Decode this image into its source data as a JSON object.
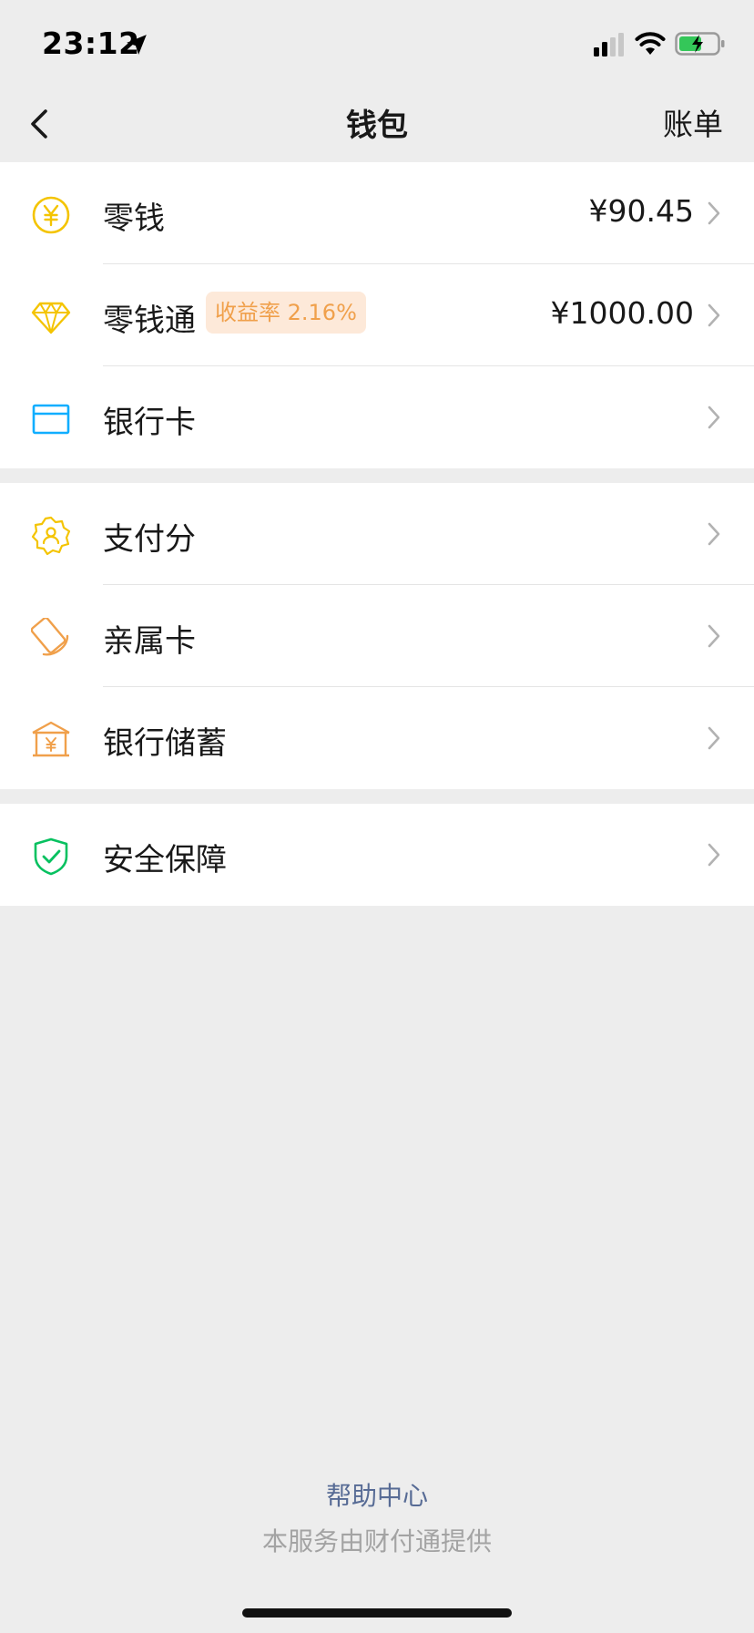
{
  "status_bar": {
    "time": "23:12"
  },
  "nav": {
    "title": "钱包",
    "right_label": "账单"
  },
  "groups": [
    {
      "items": [
        {
          "label": "零钱",
          "value": "¥90.45",
          "icon": "yuan-coin-icon"
        },
        {
          "label": "零钱通",
          "badge": "收益率 2.16%",
          "value": "¥1000.00",
          "icon": "diamond-icon"
        },
        {
          "label": "银行卡",
          "value": "",
          "icon": "bank-card-icon"
        }
      ]
    },
    {
      "items": [
        {
          "label": "支付分",
          "icon": "pay-score-icon"
        },
        {
          "label": "亲属卡",
          "icon": "family-card-icon"
        },
        {
          "label": "银行储蓄",
          "icon": "bank-savings-icon"
        }
      ]
    },
    {
      "items": [
        {
          "label": "安全保障",
          "icon": "shield-check-icon"
        }
      ]
    }
  ],
  "footer": {
    "help": "帮助中心",
    "provider": "本服务由财付通提供"
  },
  "colors": {
    "background": "#ededed",
    "coin": "#f4c400",
    "card_blue": "#10aeff",
    "orange": "#f0a04b",
    "green": "#07c160",
    "link": "#576b95"
  }
}
